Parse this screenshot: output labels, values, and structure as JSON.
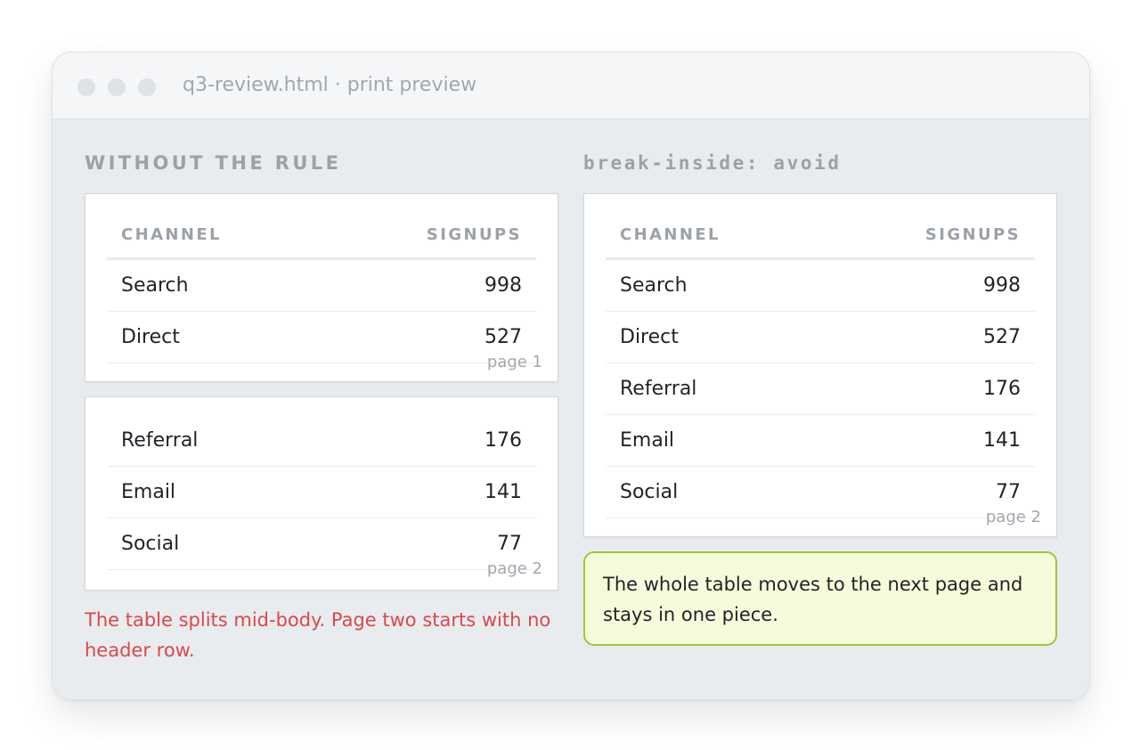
{
  "window": {
    "title": "q3-review.html · print preview"
  },
  "left": {
    "heading": "WITHOUT THE RULE",
    "page1": {
      "header": {
        "channel": "CHANNEL",
        "signups": "SIGNUPS"
      },
      "rows": [
        {
          "channel": "Search",
          "signups": "998"
        },
        {
          "channel": "Direct",
          "signups": "527"
        }
      ],
      "page_label": "page 1"
    },
    "page2": {
      "rows": [
        {
          "channel": "Referral",
          "signups": "176"
        },
        {
          "channel": "Email",
          "signups": "141"
        },
        {
          "channel": "Social",
          "signups": "77"
        }
      ],
      "page_label": "page 2"
    },
    "note": "The table splits mid-body. Page two starts with no header row."
  },
  "right": {
    "heading": "break-inside: avoid",
    "page": {
      "header": {
        "channel": "CHANNEL",
        "signups": "SIGNUPS"
      },
      "rows": [
        {
          "channel": "Search",
          "signups": "998"
        },
        {
          "channel": "Direct",
          "signups": "527"
        },
        {
          "channel": "Referral",
          "signups": "176"
        },
        {
          "channel": "Email",
          "signups": "141"
        },
        {
          "channel": "Social",
          "signups": "77"
        }
      ],
      "page_label": "page 2"
    },
    "note": "The whole table moves to the next page and stays in one piece."
  },
  "colors": {
    "error_text": "#d9494b",
    "callout_border": "#a6c23a",
    "callout_bg": "#f6fcdb",
    "window_bg": "#e9ecef"
  }
}
